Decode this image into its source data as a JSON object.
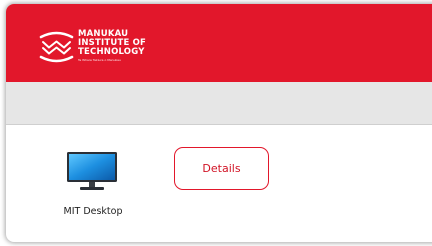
{
  "colors": {
    "brand_red": "#e2172b",
    "toolbar_grey": "#e6e6e6",
    "button_text": "#d11325"
  },
  "header": {
    "logo": {
      "icon": "manukau-waves-logo-icon",
      "line1": "MANUKAU",
      "line2": "INSTITUTE OF",
      "line3": "TECHNOLOGY",
      "tagline": "Te Whare Takiura o Manukau"
    }
  },
  "resources": [
    {
      "icon": "desktop-monitor-icon",
      "label": "MIT Desktop"
    }
  ],
  "actions": {
    "details_label": "Details"
  }
}
